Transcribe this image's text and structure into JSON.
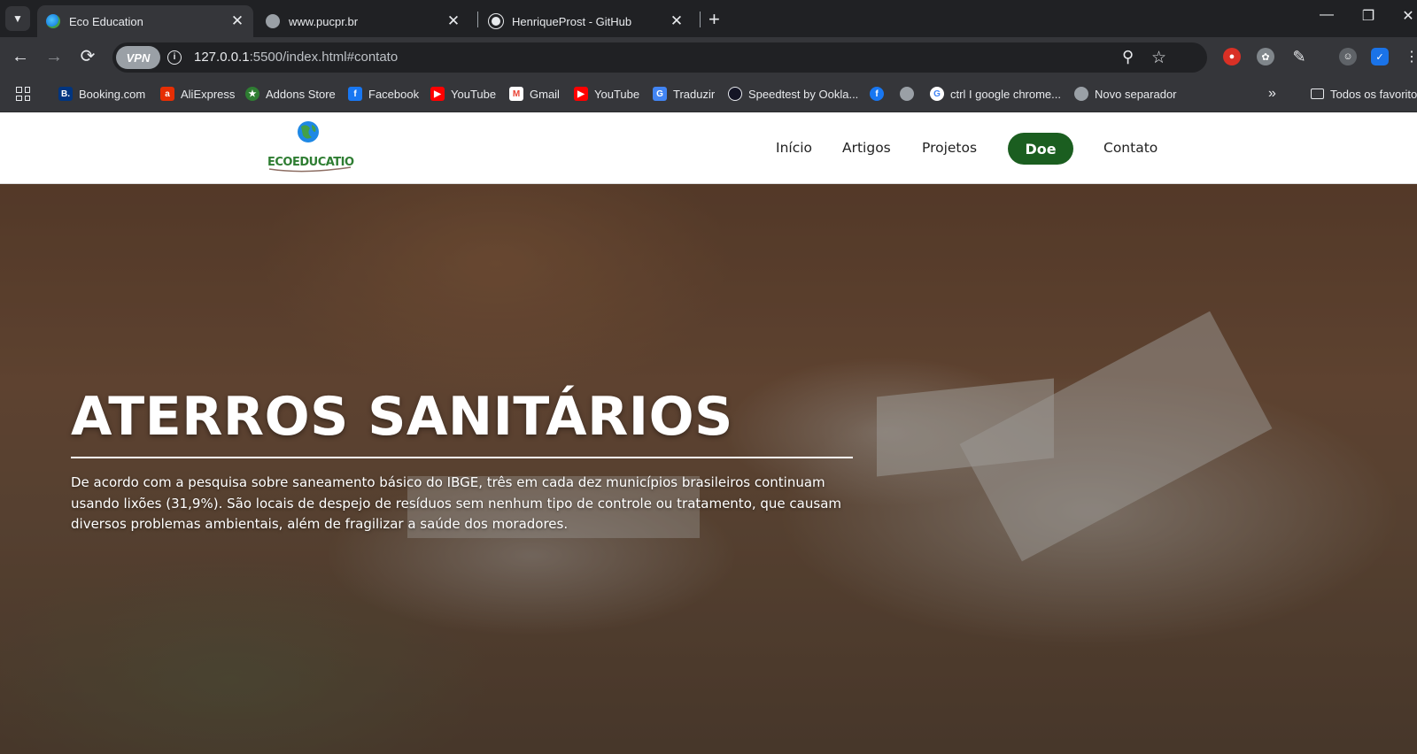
{
  "tabs": [
    {
      "title": "Eco Education",
      "active": true
    },
    {
      "title": "www.pucpr.br",
      "active": false
    },
    {
      "title": "HenriqueProst - GitHub",
      "active": false
    }
  ],
  "address_bar": {
    "vpn_label": "VPN",
    "url_host": "127.0.0.1",
    "url_rest": ":5500/index.html#contato"
  },
  "bookmarks": [
    {
      "label": "Booking.com",
      "icon": "booking-icon",
      "color": "#003580"
    },
    {
      "label": "AliExpress",
      "icon": "aliexpress-icon",
      "color": "#e62e04"
    },
    {
      "label": "Addons Store",
      "icon": "addons-icon",
      "color": "#2e7d32"
    },
    {
      "label": "Facebook",
      "icon": "facebook-icon",
      "color": "#1877f2"
    },
    {
      "label": "YouTube",
      "icon": "youtube-icon",
      "color": "#ff0000"
    },
    {
      "label": "Gmail",
      "icon": "gmail-icon",
      "color": "#ea4335"
    },
    {
      "label": "YouTube",
      "icon": "youtube-icon",
      "color": "#ff0000"
    },
    {
      "label": "Traduzir",
      "icon": "translate-icon",
      "color": "#4285f4"
    },
    {
      "label": "Speedtest by Ookla...",
      "icon": "speedtest-icon",
      "color": "#141526"
    },
    {
      "label": "ctrl I google chrome...",
      "icon": "google-icon",
      "color": "#ffffff"
    },
    {
      "label": "Novo separador",
      "icon": "globe-icon",
      "color": "#9aa0a6"
    }
  ],
  "bookmarks_folder": "Todos os favoritos",
  "site": {
    "logo_text": "ECOEDUCATION",
    "nav": [
      "Início",
      "Artigos",
      "Projetos",
      "Contato"
    ],
    "donate_button": "Doe",
    "brand_green": "#1b5e20"
  },
  "hero": {
    "title": "ATERROS SANITÁRIOS",
    "text": "De acordo com a pesquisa sobre saneamento básico do IBGE, três em cada dez municípios brasileiros continuam usando lixões (31,9%). São locais de despejo de resíduos sem nenhum tipo de controle ou tratamento, que causam diversos problemas ambientais, além de fragilizar a saúde dos moradores."
  }
}
